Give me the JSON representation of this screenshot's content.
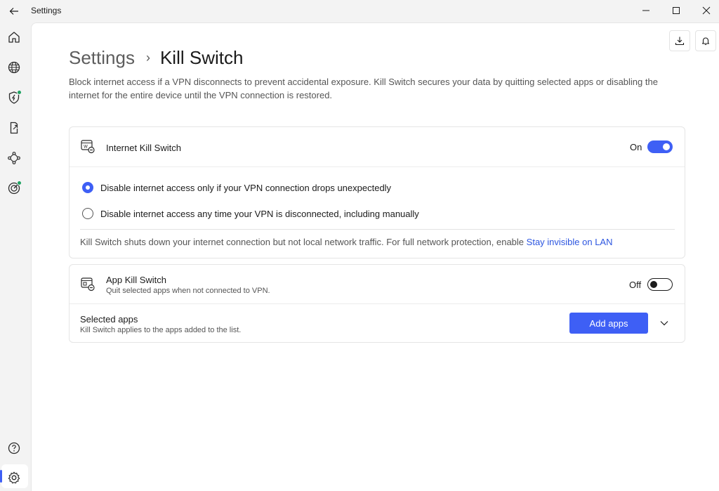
{
  "window": {
    "title": "Settings",
    "back_icon": "back-arrow-icon",
    "controls": [
      "minimize-icon",
      "maximize-icon",
      "close-icon"
    ]
  },
  "sidebar": {
    "items": [
      {
        "name": "home",
        "icon": "home-icon"
      },
      {
        "name": "globe",
        "icon": "globe-icon"
      },
      {
        "name": "shield",
        "icon": "shield-bolt-icon",
        "status": "active"
      },
      {
        "name": "split-tunneling",
        "icon": "file-arrow-icon"
      },
      {
        "name": "meshnet",
        "icon": "meshnet-icon"
      },
      {
        "name": "threat-protection",
        "icon": "target-icon",
        "status": "active"
      }
    ],
    "bottom": [
      {
        "name": "help",
        "icon": "help-icon"
      },
      {
        "name": "settings",
        "icon": "gear-icon",
        "selected": true
      }
    ]
  },
  "header": {
    "actions": [
      "download-icon",
      "bell-icon"
    ],
    "breadcrumb_parent": "Settings",
    "breadcrumb_separator": "›",
    "breadcrumb_current": "Kill Switch",
    "description": "Block internet access if a VPN disconnects to prevent accidental exposure. Kill Switch secures your data by quitting selected apps or disabling the internet for the entire device until the VPN connection is restored."
  },
  "internet_kill_switch": {
    "title": "Internet Kill Switch",
    "state_label": "On",
    "enabled": true,
    "options": [
      {
        "label": "Disable internet access only if your VPN connection drops unexpectedly",
        "checked": true
      },
      {
        "label": "Disable internet access any time your VPN is disconnected, including manually",
        "checked": false
      }
    ],
    "note_text": "Kill Switch shuts down your internet connection but not local network traffic. For full network protection, enable ",
    "note_link": "Stay invisible on LAN"
  },
  "app_kill_switch": {
    "title": "App Kill Switch",
    "subtitle": "Quit selected apps when not connected to VPN.",
    "state_label": "Off",
    "enabled": false,
    "selected_apps_title": "Selected apps",
    "selected_apps_subtitle": "Kill Switch applies to the apps added to the list.",
    "add_button": "Add apps"
  },
  "colors": {
    "accent": "#3e5ff5",
    "link": "#2d56e0",
    "status_green": "#1ea362"
  }
}
